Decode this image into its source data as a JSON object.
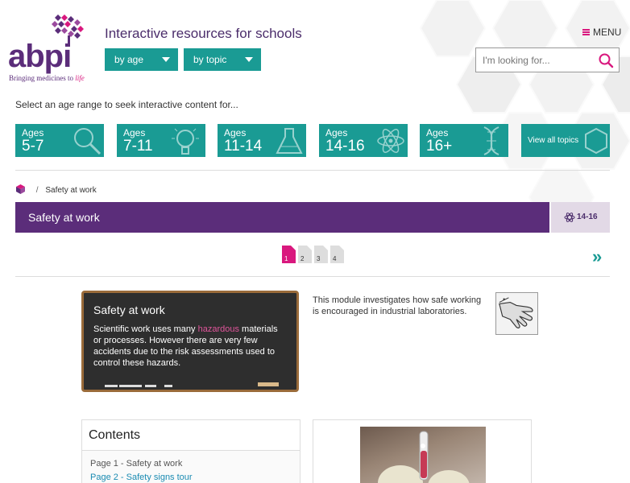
{
  "brand": {
    "logo_text": "abpi",
    "tagline": "Bringing medicines to",
    "tagline_em": "life",
    "accent": "#1a9b94",
    "purple": "#5b2d7a",
    "pink": "#d9187e"
  },
  "header": {
    "title": "Interactive resources for schools",
    "by_age": "by age",
    "by_topic": "by topic",
    "menu": "MENU",
    "search_placeholder": "I'm looking for..."
  },
  "age_prompt": "Select an age range to seek interactive content for...",
  "age_tiles": [
    {
      "label": "Ages",
      "range": "5-7",
      "icon": "magnifier-icon"
    },
    {
      "label": "Ages",
      "range": "7-11",
      "icon": "lightbulb-icon"
    },
    {
      "label": "Ages",
      "range": "11-14",
      "icon": "flask-icon"
    },
    {
      "label": "Ages",
      "range": "14-16",
      "icon": "atom-icon"
    },
    {
      "label": "Ages",
      "range": "16+",
      "icon": "dna-icon"
    }
  ],
  "view_all": "View all topics",
  "breadcrumb": {
    "current": "Safety at work"
  },
  "banner": {
    "title": "Safety at work",
    "age": "14-16"
  },
  "pages": [
    "1",
    "2",
    "3",
    "4"
  ],
  "current_page": 1,
  "blackboard": {
    "title": "Safety at work",
    "text_before": "Scientific work uses many ",
    "highlight": "hazardous",
    "text_after": " materials or processes. However there are very few accidents due to the risk assessments used to control these hazards."
  },
  "intro": "This module investigates how safe working is encouraged in industrial laboratories.",
  "contents": {
    "heading": "Contents",
    "items": [
      "Page 1 - Safety at work",
      "Page 2 - Safety signs tour"
    ]
  }
}
